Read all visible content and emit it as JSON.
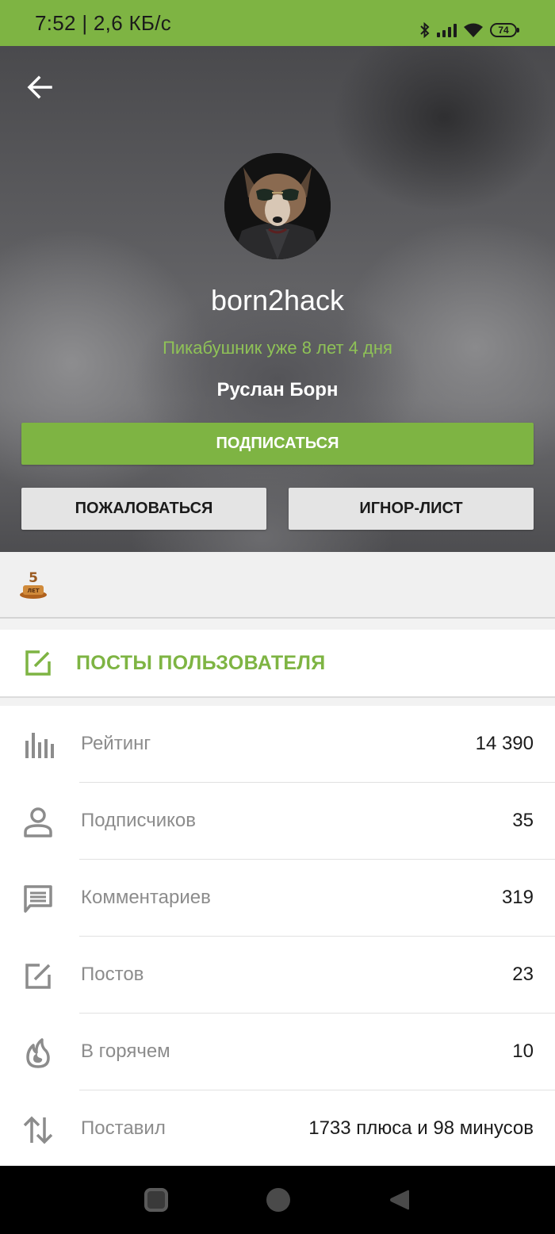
{
  "status_bar": {
    "time": "7:52 | 2,6 КБ/с",
    "battery": "74",
    "icons": [
      "bluetooth-icon",
      "signal-icon",
      "wifi-icon",
      "battery-icon"
    ]
  },
  "header": {
    "back_icon": "arrow-left-icon",
    "username": "born2hack",
    "member_since": "Пикабушник уже 8 лет 4 дня",
    "real_name": "Руслан Борн",
    "subscribe_label": "ПОДПИСАТЬСЯ",
    "report_label": "ПОЖАЛОВАТЬСЯ",
    "ignore_label": "ИГНОР-ЛИСТ"
  },
  "awards": [
    {
      "icon": "five-years-award-icon",
      "text": "5 ЛЕТ"
    }
  ],
  "posts_link": {
    "icon": "edit-square-icon",
    "label": "ПОСТЫ ПОЛЬЗОВАТЕЛЯ"
  },
  "stats": [
    {
      "icon": "bar-chart-icon",
      "label": "Рейтинг",
      "value": "14 390"
    },
    {
      "icon": "person-icon",
      "label": "Подписчиков",
      "value": "35"
    },
    {
      "icon": "comment-icon",
      "label": "Комментариев",
      "value": "319"
    },
    {
      "icon": "edit-square-icon",
      "label": "Постов",
      "value": "23"
    },
    {
      "icon": "flame-icon",
      "label": "В горячем",
      "value": "10"
    },
    {
      "icon": "swap-vertical-icon",
      "label": "Поставил",
      "value": "1733 плюса и 98 минусов"
    }
  ],
  "nav_bar": {
    "icons": [
      "recents-square-icon",
      "home-circle-icon",
      "back-triangle-icon"
    ]
  },
  "colors": {
    "accent": "#7eb443",
    "accent_text": "#8fc257",
    "label_gray": "#8c8c8c",
    "button_gray": "#e4e4e4"
  }
}
